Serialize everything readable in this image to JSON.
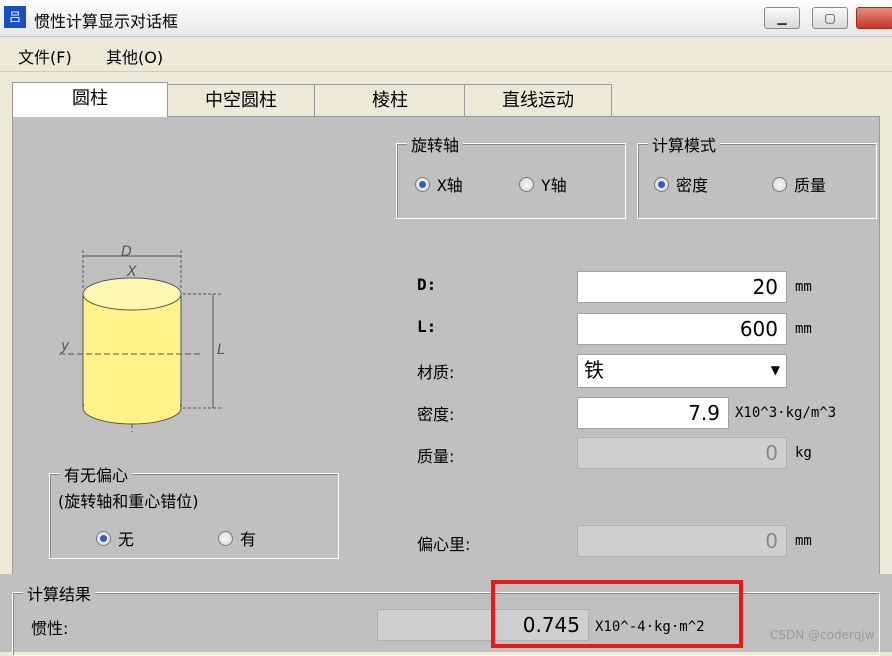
{
  "window": {
    "icon": "app-icon",
    "title": "惯性计算显示对话框",
    "min_label": "▭",
    "max_label": "▢"
  },
  "menu": [
    "文件(F)",
    "其他(O)"
  ],
  "tabs": [
    "圆柱",
    "中空圆柱",
    "棱柱",
    "直线运动"
  ],
  "rotation_axis": {
    "title": "旋转轴",
    "options": [
      "X轴",
      "Y轴"
    ],
    "selected": 0
  },
  "calc_mode": {
    "title": "计算模式",
    "options": [
      "密度",
      "质量"
    ],
    "selected": 0
  },
  "diagram": {
    "d_label": "D",
    "x_label": "X",
    "y_label": "y",
    "l_label": "L",
    "fill_color": "#fff28a"
  },
  "fields": {
    "d": {
      "label": "D:",
      "value": "20",
      "unit": "mm"
    },
    "l": {
      "label": "L:",
      "value": "600",
      "unit": "mm"
    },
    "material": {
      "label": "材质:",
      "value": "铁"
    },
    "density": {
      "label": "密度:",
      "value": "7.9",
      "unit": "X10^3·kg/m^3"
    },
    "mass": {
      "label": "质量:",
      "value": "0",
      "unit": "kg"
    },
    "eccentric": {
      "label": "偏心里:",
      "value": "0",
      "unit": "mm"
    }
  },
  "eccentric_group": {
    "title": "有无偏心",
    "subtitle": "(旋转轴和重心错位)",
    "options": [
      "无",
      "有"
    ],
    "selected": 0
  },
  "result": {
    "title": "计算结果",
    "label": "惯性:",
    "value": "0.745",
    "unit": "X10^-4·kg·m^2",
    "highlight_color": "#e31b1b"
  },
  "watermark": "CSDN @coderqjw"
}
